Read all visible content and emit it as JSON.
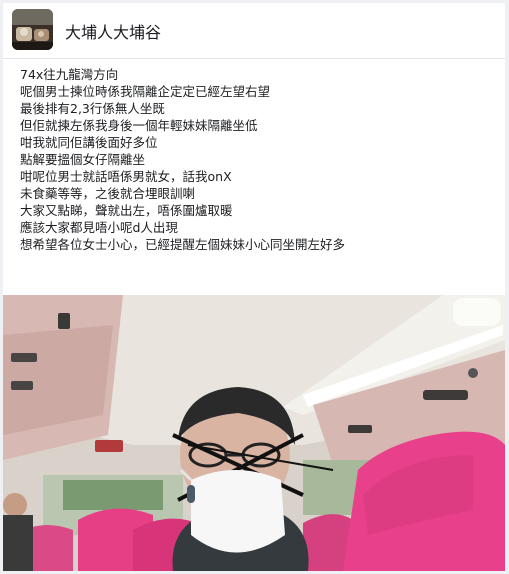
{
  "group": {
    "name": "大埔人大埔谷",
    "avatar_icon": "group-avatar-photo"
  },
  "post": {
    "lines": [
      "74x往九龍灣方向",
      "呢個男士揀位時係我隔離企定定已經左望右望",
      "最後排有2,3行係無人坐既",
      "但佢就揀左係我身後一個年輕妹妹隔離坐低",
      "咁我就同佢講後面好多位",
      "點解要搵個女仔隔離坐",
      "咁呢位男士就話唔係男就女，話我onX",
      "未食藥等等，之後就合埋眼訓喇",
      "大家又點睇，聲就出左，唔係圍爐取暖",
      "應該大家都見唔小呢d人出現",
      "想希望各位女士小心，已經提醒左個妹妹小心同坐開左好多"
    ]
  },
  "photo": {
    "subject": "bus-interior-photo",
    "colors": {
      "seat": "#e63f86",
      "ceiling": "#e9e4de",
      "mask": "#f7f7f7",
      "light": "#fbfbf8"
    }
  }
}
